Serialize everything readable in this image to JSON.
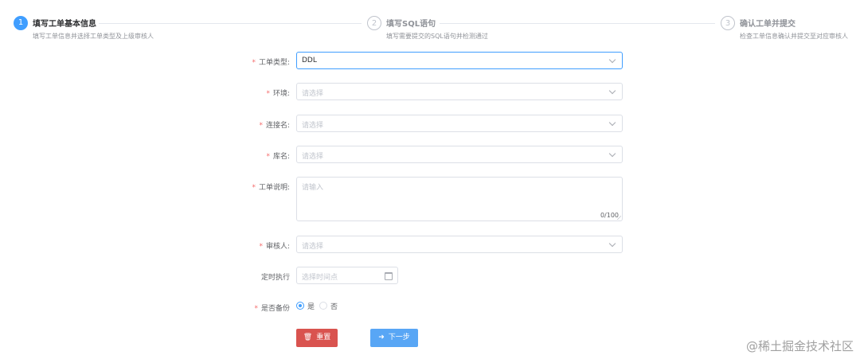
{
  "steps": [
    {
      "num": "1",
      "title": "填写工单基本信息",
      "desc": "填写工单信息并选择工单类型及上级审核人"
    },
    {
      "num": "2",
      "title": "填写SQL语句",
      "desc": "填写需要提交的SQL语句并检测通过"
    },
    {
      "num": "3",
      "title": "确认工单并提交",
      "desc": "检查工单信息确认并提交至对应审核人"
    }
  ],
  "form": {
    "required_mark": "*",
    "order_type": {
      "label": "工单类型:",
      "value": "DDL"
    },
    "env": {
      "label": "环境:",
      "placeholder": "请选择"
    },
    "connection": {
      "label": "连接名:",
      "placeholder": "请选择"
    },
    "database": {
      "label": "库名:",
      "placeholder": "请选择"
    },
    "description": {
      "label": "工单说明:",
      "placeholder": "请输入",
      "count": "0/100"
    },
    "reviewer": {
      "label": "审核人:",
      "placeholder": "请选择"
    },
    "schedule": {
      "label": "定时执行",
      "placeholder": "选择时间点"
    },
    "backup": {
      "label": "是否备份",
      "options": [
        "是",
        "否"
      ],
      "selected": "是"
    }
  },
  "buttons": {
    "reset": "重置",
    "next": "下一步"
  },
  "icons": {
    "reset": "trash-icon",
    "next": "arrow-right-icon"
  },
  "colors": {
    "primary": "#409eff",
    "danger": "#d9534f",
    "next": "#58a6f5",
    "required": "#f56c6c"
  },
  "watermark": "@稀土掘金技术社区"
}
